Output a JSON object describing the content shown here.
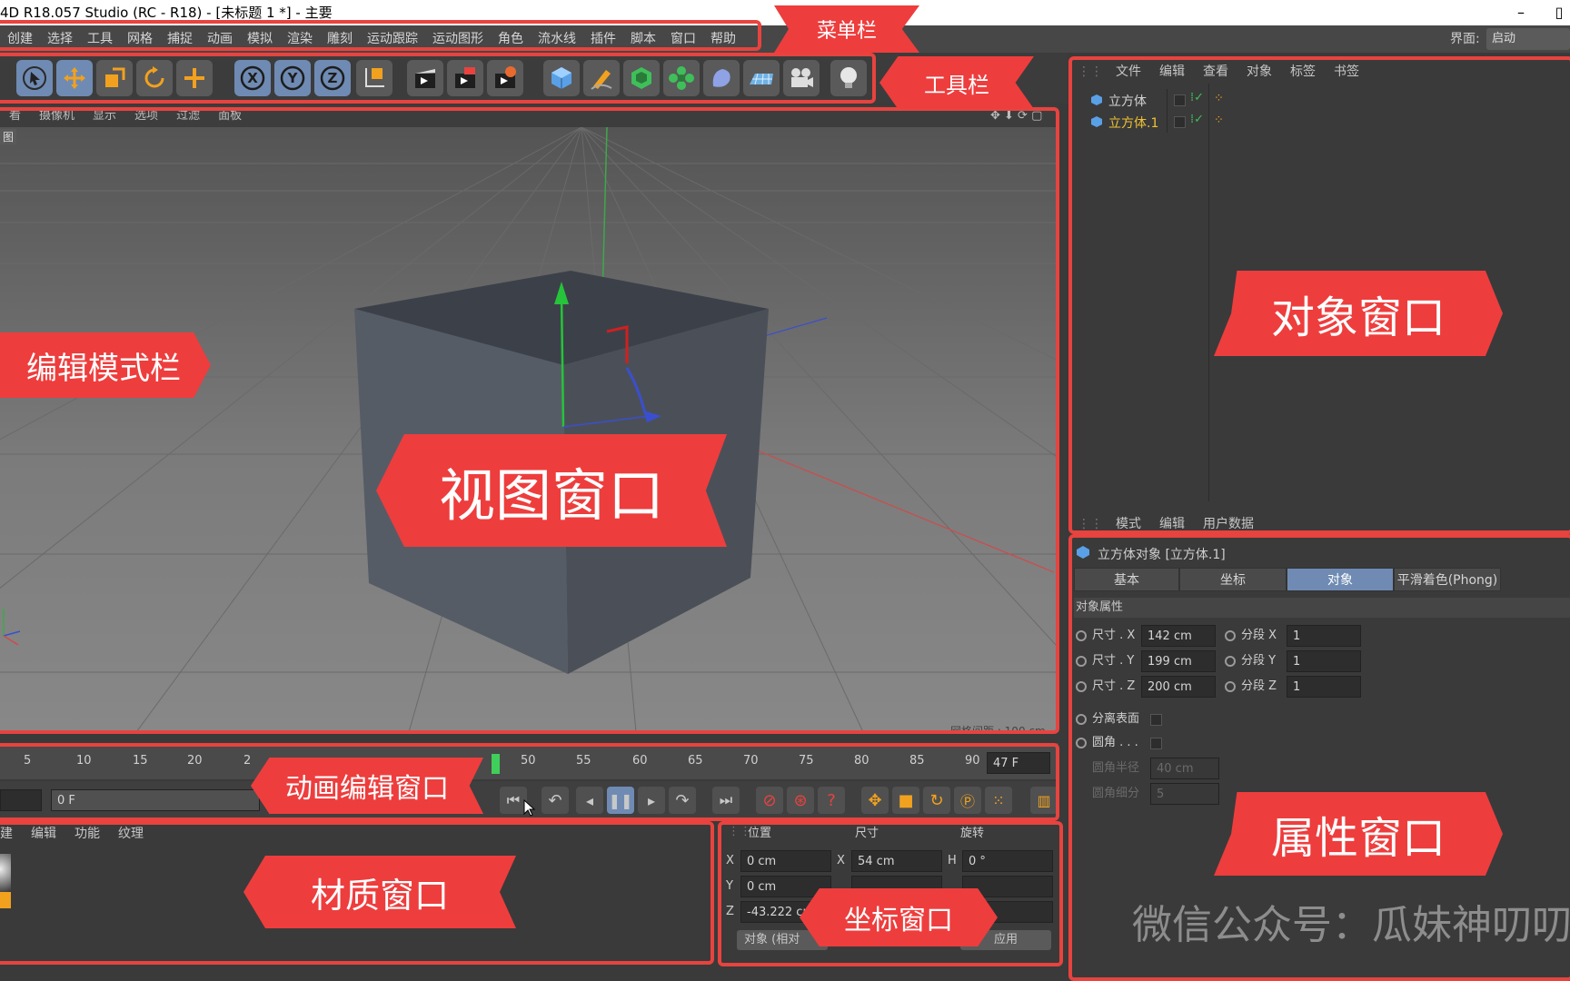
{
  "window": {
    "title": "4D R18.057 Studio (RC - R18) - [未标题 1 *] - 主要",
    "minimize": "–"
  },
  "menu": [
    "创建",
    "选择",
    "工具",
    "网格",
    "捕捉",
    "动画",
    "模拟",
    "渲染",
    "雕刻",
    "运动跟踪",
    "运动图形",
    "角色",
    "流水线",
    "插件",
    "脚本",
    "窗口",
    "帮助"
  ],
  "layout": {
    "label": "界面:",
    "value": "启动"
  },
  "viewport": {
    "menu": [
      "看",
      "摄像机",
      "显示",
      "选项",
      "过滤",
      "面板"
    ],
    "tag": "图",
    "grid_distance": "网格间距 : 100 cm"
  },
  "object_manager": {
    "menu": [
      "文件",
      "编辑",
      "查看",
      "对象",
      "标签",
      "书签"
    ],
    "objects": [
      {
        "name": "立方体",
        "color": "#d2d2d2"
      },
      {
        "name": "立方体.1",
        "color": "#f1c232"
      }
    ]
  },
  "attributes": {
    "menu": [
      "模式",
      "编辑",
      "用户数据"
    ],
    "title": "立方体对象 [立方体.1]",
    "tabs": [
      "基本",
      "坐标",
      "对象",
      "平滑着色(Phong)"
    ],
    "active_tab": "对象",
    "section": "对象属性",
    "size": [
      {
        "label": "尺寸 . X",
        "value": "142 cm"
      },
      {
        "label": "尺寸 . Y",
        "value": "199 cm"
      },
      {
        "label": "尺寸 . Z",
        "value": "200 cm"
      }
    ],
    "segments": [
      {
        "label": "分段 X",
        "value": "1"
      },
      {
        "label": "分段 Y",
        "value": "1"
      },
      {
        "label": "分段 Z",
        "value": "1"
      }
    ],
    "separate_surfaces": "分离表面",
    "fillet": "圆角 . . .",
    "fillet_radius": {
      "label": "圆角半径",
      "value": "40 cm"
    },
    "fillet_subdivision": {
      "label": "圆角细分",
      "value": "5"
    }
  },
  "timeline": {
    "ticks": [
      "5",
      "10",
      "15",
      "20",
      "2",
      "50",
      "55",
      "60",
      "65",
      "70",
      "75",
      "80",
      "85",
      "90"
    ],
    "current_frame": "47 F",
    "start_field": "0 F",
    "current_frame_value": 47
  },
  "materials": {
    "menu": [
      "建",
      "编辑",
      "功能",
      "纹理"
    ]
  },
  "coordinates": {
    "headers": [
      "位置",
      "尺寸",
      "旋转"
    ],
    "pos": [
      {
        "axis": "X",
        "value": "0 cm"
      },
      {
        "axis": "Y",
        "value": "0 cm"
      },
      {
        "axis": "Z",
        "value": "-43.222 cm"
      }
    ],
    "size": [
      {
        "axis": "X",
        "value": "54 cm"
      }
    ],
    "rot": [
      {
        "axis": "H",
        "value": "0 °"
      }
    ],
    "mode": "对象 (相对",
    "apply": "应用"
  },
  "annotations": {
    "menubar": "菜单栏",
    "toolbar": "工具栏",
    "object": "对象窗口",
    "editmode": "编辑模式栏",
    "view": "视图窗口",
    "anim": "动画编辑窗口",
    "attr": "属性窗口",
    "material": "材质窗口",
    "coord": "坐标窗口"
  },
  "watermark": "微信公众号：瓜妹神叨叨",
  "colors": {
    "annotation": "#ee3d3d",
    "accent": "#6f8bb3",
    "selected_object": "#f1c232"
  }
}
